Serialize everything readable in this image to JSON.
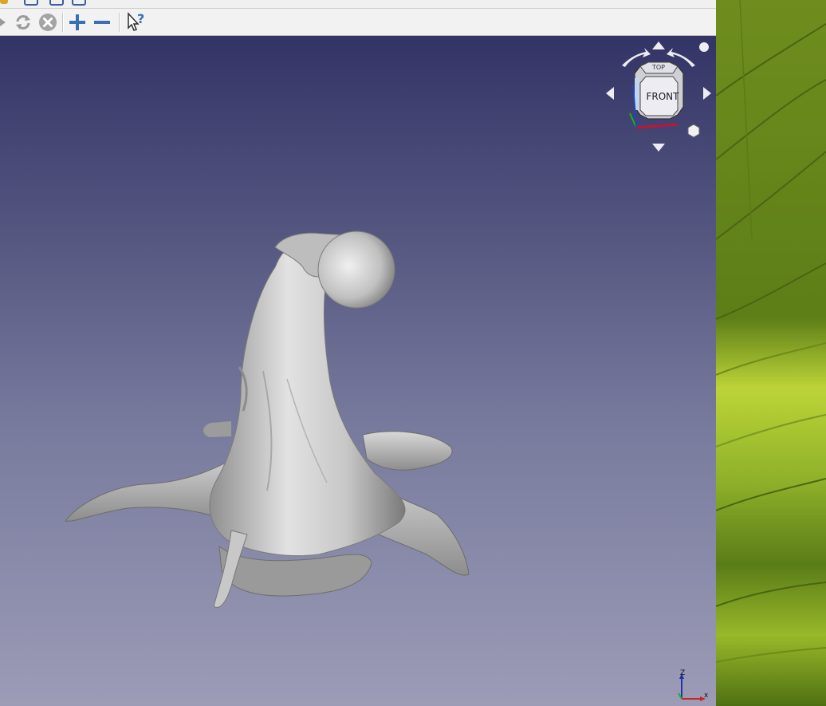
{
  "toolbar": {
    "items": [
      {
        "name": "arrow-right-icon"
      },
      {
        "name": "refresh-icon"
      },
      {
        "name": "stop-icon"
      },
      {
        "name": "zoom-in-icon"
      },
      {
        "name": "zoom-out-icon"
      },
      {
        "name": "whats-this-icon"
      }
    ]
  },
  "navcube": {
    "top_label": "TOP",
    "front_label": "FRONT"
  },
  "axis_triad": {
    "z_label": "Z",
    "x_label": "x"
  },
  "colors": {
    "viewport_top": "#333466",
    "viewport_bottom": "#9c9cb7",
    "icon_blue": "#3a6fb6",
    "model_gray": "#cfcfcf"
  }
}
